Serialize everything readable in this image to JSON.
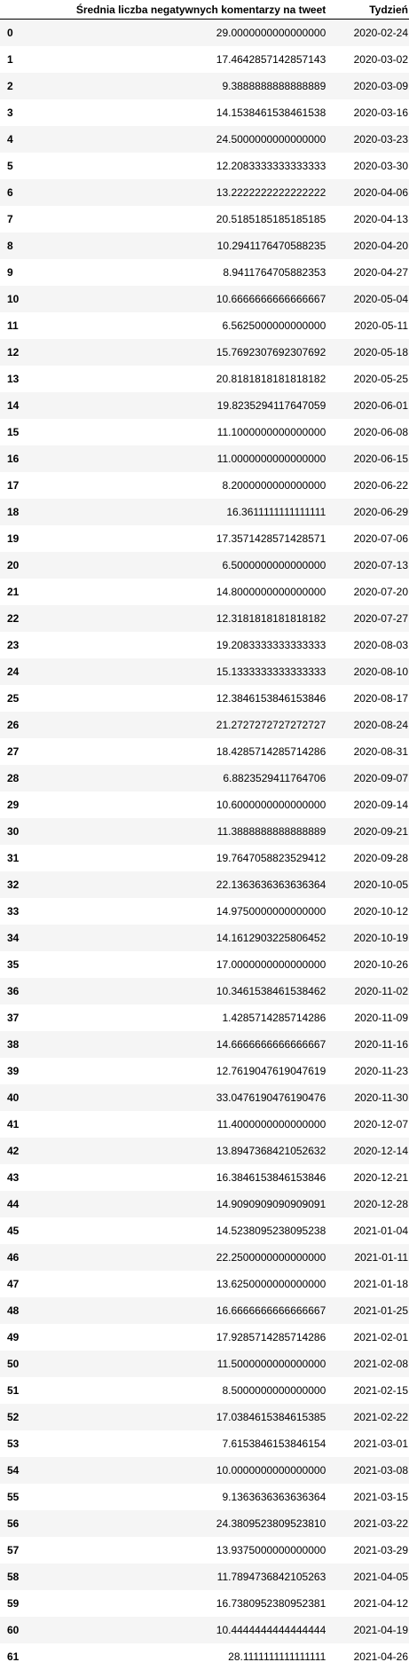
{
  "table": {
    "columns": [
      "",
      "Średnia liczba negatywnych komentarzy na tweet",
      "Tydzień"
    ],
    "rows": [
      [
        "0",
        "29.0000000000000000",
        "2020-02-24"
      ],
      [
        "1",
        "17.4642857142857143",
        "2020-03-02"
      ],
      [
        "2",
        "9.3888888888888889",
        "2020-03-09"
      ],
      [
        "3",
        "14.1538461538461538",
        "2020-03-16"
      ],
      [
        "4",
        "24.5000000000000000",
        "2020-03-23"
      ],
      [
        "5",
        "12.2083333333333333",
        "2020-03-30"
      ],
      [
        "6",
        "13.2222222222222222",
        "2020-04-06"
      ],
      [
        "7",
        "20.5185185185185185",
        "2020-04-13"
      ],
      [
        "8",
        "10.2941176470588235",
        "2020-04-20"
      ],
      [
        "9",
        "8.9411764705882353",
        "2020-04-27"
      ],
      [
        "10",
        "10.6666666666666667",
        "2020-05-04"
      ],
      [
        "11",
        "6.5625000000000000",
        "2020-05-11"
      ],
      [
        "12",
        "15.7692307692307692",
        "2020-05-18"
      ],
      [
        "13",
        "20.8181818181818182",
        "2020-05-25"
      ],
      [
        "14",
        "19.8235294117647059",
        "2020-06-01"
      ],
      [
        "15",
        "11.1000000000000000",
        "2020-06-08"
      ],
      [
        "16",
        "11.0000000000000000",
        "2020-06-15"
      ],
      [
        "17",
        "8.2000000000000000",
        "2020-06-22"
      ],
      [
        "18",
        "16.3611111111111111",
        "2020-06-29"
      ],
      [
        "19",
        "17.3571428571428571",
        "2020-07-06"
      ],
      [
        "20",
        "6.5000000000000000",
        "2020-07-13"
      ],
      [
        "21",
        "14.8000000000000000",
        "2020-07-20"
      ],
      [
        "22",
        "12.3181818181818182",
        "2020-07-27"
      ],
      [
        "23",
        "19.2083333333333333",
        "2020-08-03"
      ],
      [
        "24",
        "15.1333333333333333",
        "2020-08-10"
      ],
      [
        "25",
        "12.3846153846153846",
        "2020-08-17"
      ],
      [
        "26",
        "21.2727272727272727",
        "2020-08-24"
      ],
      [
        "27",
        "18.4285714285714286",
        "2020-08-31"
      ],
      [
        "28",
        "6.8823529411764706",
        "2020-09-07"
      ],
      [
        "29",
        "10.6000000000000000",
        "2020-09-14"
      ],
      [
        "30",
        "11.3888888888888889",
        "2020-09-21"
      ],
      [
        "31",
        "19.7647058823529412",
        "2020-09-28"
      ],
      [
        "32",
        "22.1363636363636364",
        "2020-10-05"
      ],
      [
        "33",
        "14.9750000000000000",
        "2020-10-12"
      ],
      [
        "34",
        "14.1612903225806452",
        "2020-10-19"
      ],
      [
        "35",
        "17.0000000000000000",
        "2020-10-26"
      ],
      [
        "36",
        "10.3461538461538462",
        "2020-11-02"
      ],
      [
        "37",
        "1.4285714285714286",
        "2020-11-09"
      ],
      [
        "38",
        "14.6666666666666667",
        "2020-11-16"
      ],
      [
        "39",
        "12.7619047619047619",
        "2020-11-23"
      ],
      [
        "40",
        "33.0476190476190476",
        "2020-11-30"
      ],
      [
        "41",
        "11.4000000000000000",
        "2020-12-07"
      ],
      [
        "42",
        "13.8947368421052632",
        "2020-12-14"
      ],
      [
        "43",
        "16.3846153846153846",
        "2020-12-21"
      ],
      [
        "44",
        "14.9090909090909091",
        "2020-12-28"
      ],
      [
        "45",
        "14.5238095238095238",
        "2021-01-04"
      ],
      [
        "46",
        "22.2500000000000000",
        "2021-01-11"
      ],
      [
        "47",
        "13.6250000000000000",
        "2021-01-18"
      ],
      [
        "48",
        "16.6666666666666667",
        "2021-01-25"
      ],
      [
        "49",
        "17.9285714285714286",
        "2021-02-01"
      ],
      [
        "50",
        "11.5000000000000000",
        "2021-02-08"
      ],
      [
        "51",
        "8.5000000000000000",
        "2021-02-15"
      ],
      [
        "52",
        "17.0384615384615385",
        "2021-02-22"
      ],
      [
        "53",
        "7.6153846153846154",
        "2021-03-01"
      ],
      [
        "54",
        "10.0000000000000000",
        "2021-03-08"
      ],
      [
        "55",
        "9.1363636363636364",
        "2021-03-15"
      ],
      [
        "56",
        "24.3809523809523810",
        "2021-03-22"
      ],
      [
        "57",
        "13.9375000000000000",
        "2021-03-29"
      ],
      [
        "58",
        "11.7894736842105263",
        "2021-04-05"
      ],
      [
        "59",
        "16.7380952380952381",
        "2021-04-12"
      ],
      [
        "60",
        "10.4444444444444444",
        "2021-04-19"
      ],
      [
        "61",
        "28.1111111111111111",
        "2021-04-26"
      ]
    ]
  }
}
